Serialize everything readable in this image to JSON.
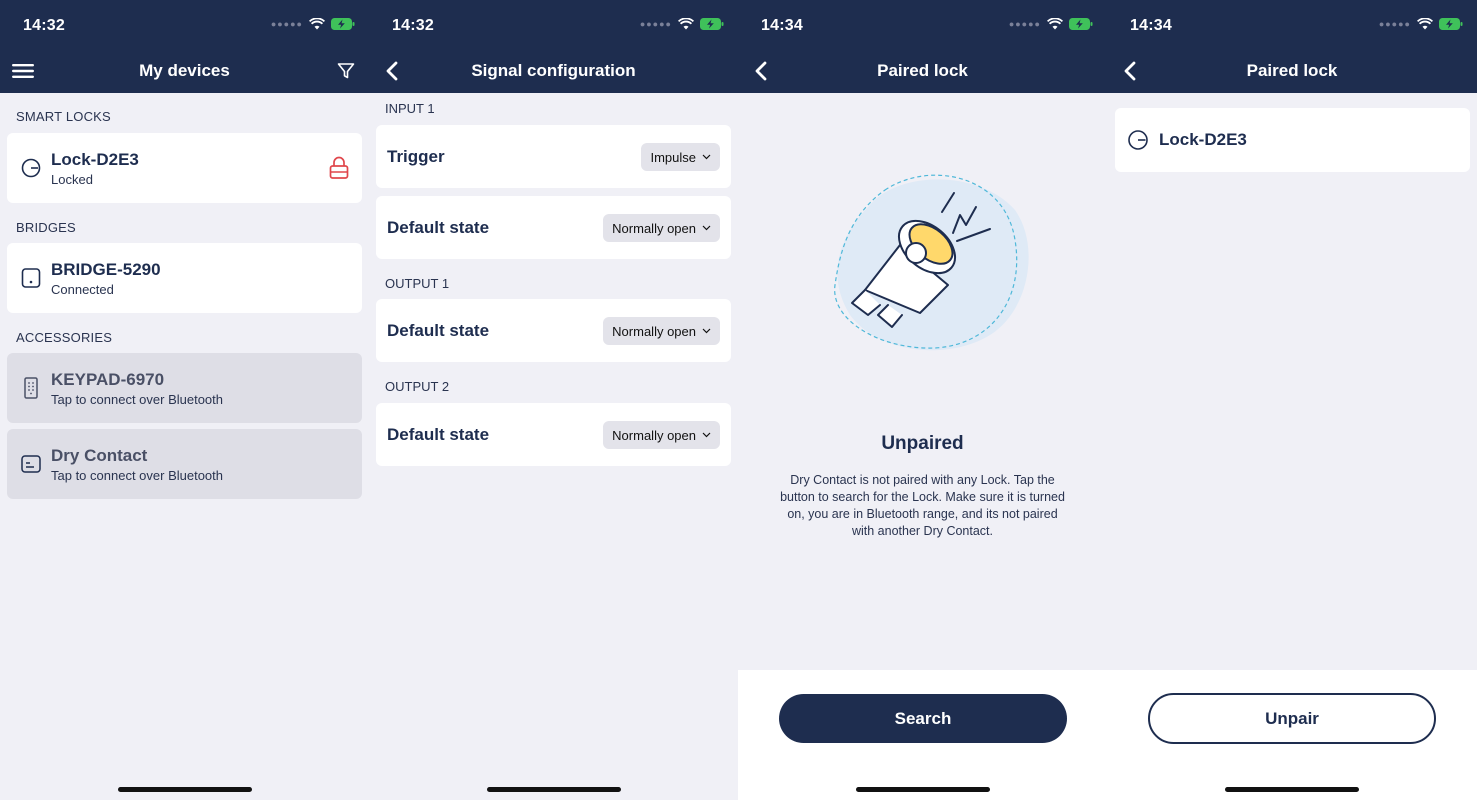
{
  "screens": [
    {
      "time": "14:32",
      "title": "My devices",
      "sections": {
        "smart_locks": "SMART LOCKS",
        "bridges": "BRIDGES",
        "accessories": "ACCESSORIES"
      },
      "devices": [
        {
          "name": "Lock-D2E3",
          "status": "Locked"
        },
        {
          "name": "BRIDGE-5290",
          "status": "Connected"
        },
        {
          "name": "KEYPAD-6970",
          "status": "Tap to connect over Bluetooth"
        },
        {
          "name": "Dry Contact",
          "status": "Tap to connect over Bluetooth"
        }
      ],
      "icons": {
        "menu": "hamburger-menu-icon",
        "filter": "filter-icon",
        "lock_state": "unlocked-padlock-icon"
      }
    },
    {
      "time": "14:32",
      "title": "Signal configuration",
      "groups": [
        {
          "label": "INPUT 1",
          "rows": [
            {
              "label": "Trigger",
              "value": "Impulse"
            },
            {
              "label": "Default state",
              "value": "Normally open"
            }
          ]
        },
        {
          "label": "OUTPUT 1",
          "rows": [
            {
              "label": "Default state",
              "value": "Normally open"
            }
          ]
        },
        {
          "label": "OUTPUT 2",
          "rows": [
            {
              "label": "Default state",
              "value": "Normally open"
            }
          ]
        }
      ]
    },
    {
      "time": "14:34",
      "title": "Paired lock",
      "heading": "Unpaired",
      "description": "Dry Contact is not paired with any Lock. Tap the button to search for the Lock. Make sure it is turned on, you are in Bluetooth range, and its not paired with another Dry Contact.",
      "button": "Search"
    },
    {
      "time": "14:34",
      "title": "Paired lock",
      "lock_name": "Lock-D2E3",
      "button": "Unpair"
    }
  ],
  "colors": {
    "navy": "#1e2d4f",
    "background": "#f0f0f6",
    "alert_red": "#e0474c",
    "illustration_yellow": "#ffd86b",
    "illustration_blob": "#dfeaf6",
    "dashed_outline": "#4fb8d9"
  }
}
